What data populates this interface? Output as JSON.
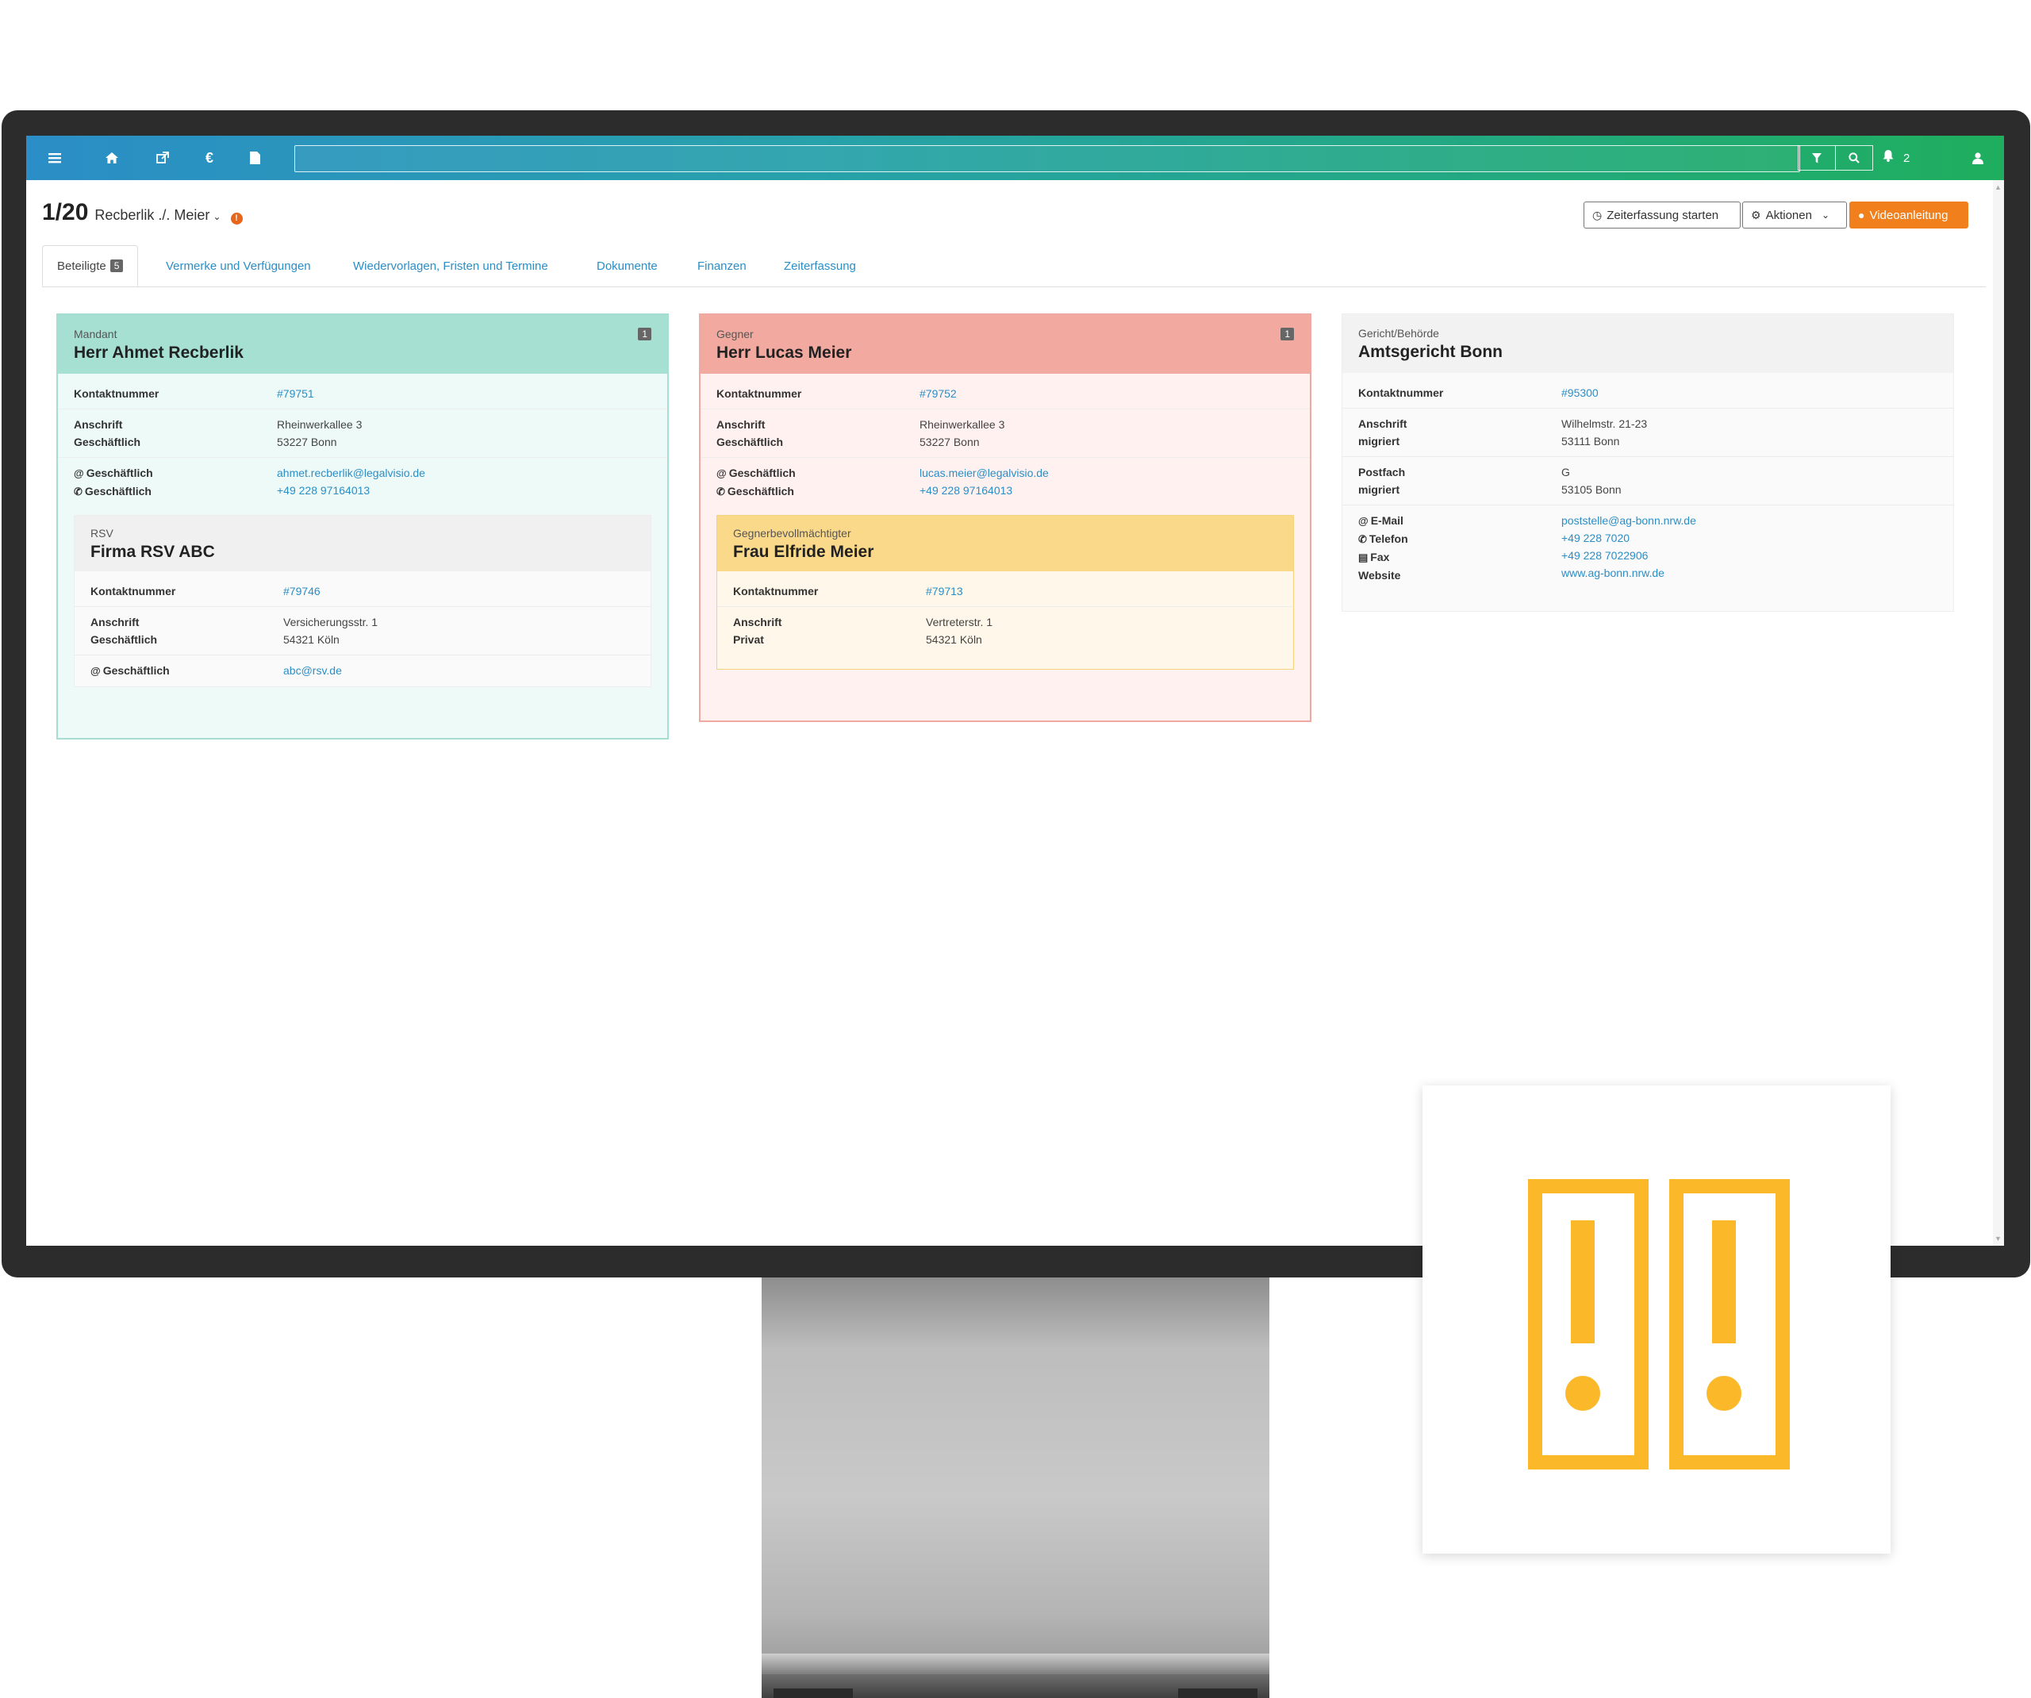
{
  "navbar": {
    "icons": [
      "menu-icon",
      "home-icon",
      "external-link-icon",
      "euro-icon",
      "document-icon",
      "filter-icon",
      "search-icon",
      "bell-icon",
      "user-icon"
    ],
    "search_value": "",
    "notification_count": "2",
    "colors": [
      "#2b8ec6",
      "#1fae5e"
    ]
  },
  "case": {
    "number": "1/20",
    "title": "Recberlik ./. Meier",
    "warning_icon": "warning-icon"
  },
  "header_buttons": {
    "zeiterfassung": "Zeiterfassung starten",
    "aktionen": "Aktionen",
    "video": "Videoanleitung",
    "video_color": "#f07f1c"
  },
  "tabs": [
    {
      "label": "Beteiligte",
      "badge": "5",
      "active": true
    },
    {
      "label": "Vermerke und Verfügungen"
    },
    {
      "label": "Wiedervorlagen, Fristen und Termine"
    },
    {
      "label": "Dokumente"
    },
    {
      "label": "Finanzen"
    },
    {
      "label": "Zeiterfassung"
    }
  ],
  "cards": {
    "mandant": {
      "role": "Mandant",
      "name": "Herr Ahmet Recberlik",
      "count": "1",
      "kontakt_label": "Kontaktnummer",
      "kontakt": "#79751",
      "anschrift_label": "Anschrift",
      "anschrift_type": "Geschäftlich",
      "address_line1": "Rheinwerkallee 3",
      "address_line2": "53227 Bonn",
      "email_label": "Geschäftlich",
      "email": "ahmet.recberlik@legalvisio.de",
      "phone_label": "Geschäftlich",
      "phone": "+49 228 97164013",
      "sub": {
        "role": "RSV",
        "name": "Firma RSV ABC",
        "kontakt_label": "Kontaktnummer",
        "kontakt": "#79746",
        "anschrift_label": "Anschrift",
        "anschrift_type": "Geschäftlich",
        "address_line1": "Versicherungsstr. 1",
        "address_line2": "54321 Köln",
        "email_label": "Geschäftlich",
        "email": "abc@rsv.de"
      }
    },
    "gegner": {
      "role": "Gegner",
      "name": "Herr Lucas Meier",
      "count": "1",
      "kontakt_label": "Kontaktnummer",
      "kontakt": "#79752",
      "anschrift_label": "Anschrift",
      "anschrift_type": "Geschäftlich",
      "address_line1": "Rheinwerkallee 3",
      "address_line2": "53227 Bonn",
      "email_label": "Geschäftlich",
      "email": "lucas.meier@legalvisio.de",
      "phone_label": "Geschäftlich",
      "phone": "+49 228 97164013",
      "sub": {
        "role": "Gegnerbevollmächtigter",
        "name": "Frau Elfride Meier",
        "kontakt_label": "Kontaktnummer",
        "kontakt": "#79713",
        "anschrift_label": "Anschrift",
        "anschrift_type": "Privat",
        "address_line1": "Vertreterstr. 1",
        "address_line2": "54321 Köln"
      }
    },
    "gericht": {
      "role": "Gericht/Behörde",
      "name": "Amtsgericht Bonn",
      "kontakt_label": "Kontaktnummer",
      "kontakt": "#95300",
      "anschrift_label": "Anschrift",
      "anschrift_type": "migriert",
      "address_line1": "Wilhelmstr. 21-23",
      "address_line2": "53111 Bonn",
      "postfach_label": "Postfach",
      "postfach_type": "migriert",
      "postfach_line1": "G",
      "postfach_line2": "53105 Bonn",
      "email_label": "E-Mail",
      "email": "poststelle@ag-bonn.nrw.de",
      "phone_label": "Telefon",
      "phone": "+49 228 7020",
      "fax_label": "Fax",
      "fax": "+49 228 7022906",
      "website_label": "Website",
      "website": "www.ag-bonn.nrw.de"
    }
  },
  "logo": {
    "icon": "folders-exclamation-logo",
    "color": "#fbb829"
  }
}
